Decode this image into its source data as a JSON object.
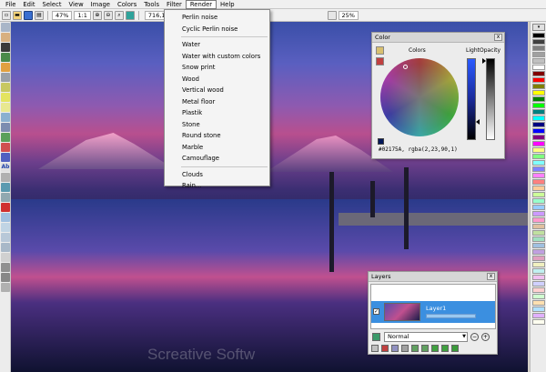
{
  "menubar": {
    "items": [
      "File",
      "Edit",
      "Select",
      "View",
      "Image",
      "Colors",
      "Tools",
      "Filter",
      "Render",
      "Help"
    ],
    "active": "Render"
  },
  "toolbar": {
    "zoom": "47%",
    "ratio": "1:1",
    "coords": "716,1",
    "opacity": "25%"
  },
  "render_menu": {
    "items": [
      "Perlin noise",
      "Cyclic Perlin noise",
      "Water",
      "Water with custom colors",
      "Snow print",
      "Wood",
      "Vertical wood",
      "Metal floor",
      "Plastik",
      "Stone",
      "Round stone",
      "Marble",
      "Camouflage",
      "Clouds",
      "Rain..."
    ]
  },
  "color_panel": {
    "title": "Color",
    "colors_label": "Colors",
    "light_label": "Light",
    "opacity_label": "Opacity",
    "value_text": "#02175A, rgba(2,23,90,1)",
    "current_color": "#02175A"
  },
  "layers_panel": {
    "title": "Layers",
    "layer_name": "Layer1",
    "blend_mode": "Normal",
    "close": "x"
  },
  "watermark": "Screative Softw",
  "palette": [
    "#000000",
    "#404040",
    "#7f7f7f",
    "#a0a0a0",
    "#c0c0c0",
    "#ffffff",
    "#800000",
    "#ff0000",
    "#808000",
    "#ffff00",
    "#008000",
    "#00ff00",
    "#008080",
    "#00ffff",
    "#000080",
    "#0000ff",
    "#800080",
    "#ff00ff",
    "#ffff80",
    "#80ff80",
    "#80ffff",
    "#8080ff",
    "#ff80ff",
    "#ff8080",
    "#ffcc99",
    "#ccff99",
    "#99ffcc",
    "#99ccff",
    "#cc99ff",
    "#ff99cc",
    "#e0c0a0",
    "#c0e0a0",
    "#a0e0c0",
    "#a0c0e0",
    "#c0a0e0",
    "#e0a0c0",
    "#f0f0c0",
    "#c0f0f0",
    "#f0c0f0",
    "#d0d0ff",
    "#ffd0d0",
    "#d0ffd0",
    "#ffe0b0",
    "#b0e0ff",
    "#e0b0ff",
    "#fffff0"
  ]
}
